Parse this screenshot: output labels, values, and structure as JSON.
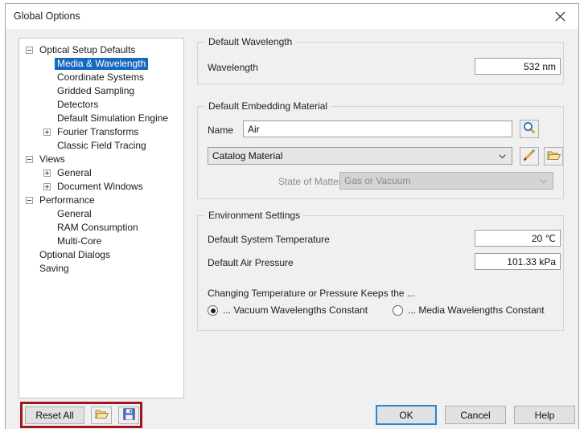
{
  "window": {
    "title": "Global Options",
    "close_icon": "close-icon"
  },
  "tree": {
    "nodes": [
      {
        "label": "Optical Setup Defaults",
        "indent": 0,
        "toggle": "minus",
        "selected": false
      },
      {
        "label": "Media & Wavelength",
        "indent": 1,
        "toggle": "none",
        "selected": true
      },
      {
        "label": "Coordinate Systems",
        "indent": 1,
        "toggle": "none",
        "selected": false
      },
      {
        "label": "Gridded Sampling",
        "indent": 1,
        "toggle": "none",
        "selected": false
      },
      {
        "label": "Detectors",
        "indent": 1,
        "toggle": "none",
        "selected": false
      },
      {
        "label": "Default Simulation Engine",
        "indent": 1,
        "toggle": "none",
        "selected": false
      },
      {
        "label": "Fourier Transforms",
        "indent": 1,
        "toggle": "plus",
        "selected": false
      },
      {
        "label": "Classic Field Tracing",
        "indent": 1,
        "toggle": "none",
        "selected": false
      },
      {
        "label": "Views",
        "indent": 0,
        "toggle": "minus",
        "selected": false
      },
      {
        "label": "General",
        "indent": 1,
        "toggle": "plus",
        "selected": false
      },
      {
        "label": "Document Windows",
        "indent": 1,
        "toggle": "plus",
        "selected": false
      },
      {
        "label": "Performance",
        "indent": 0,
        "toggle": "minus",
        "selected": false
      },
      {
        "label": "General",
        "indent": 1,
        "toggle": "none",
        "selected": false
      },
      {
        "label": "RAM Consumption",
        "indent": 1,
        "toggle": "none",
        "selected": false
      },
      {
        "label": "Multi-Core",
        "indent": 1,
        "toggle": "none",
        "selected": false
      },
      {
        "label": "Optional Dialogs",
        "indent": 0,
        "toggle": "none",
        "selected": false
      },
      {
        "label": "Saving",
        "indent": 0,
        "toggle": "none",
        "selected": false
      }
    ]
  },
  "wavelength_group": {
    "title": "Default Wavelength",
    "label": "Wavelength",
    "value": "532 nm"
  },
  "embedding_group": {
    "title": "Default Embedding Material",
    "name_label": "Name",
    "name_value": "Air",
    "search_icon": "search-icon",
    "material_type": "Catalog Material",
    "edit_icon": "pencil-icon",
    "open_icon": "folder-open-icon",
    "state_label": "State of Matter",
    "state_value": "Gas or Vacuum"
  },
  "environment_group": {
    "title": "Environment Settings",
    "temperature_label": "Default System Temperature",
    "temperature_value": "20 ℃",
    "pressure_label": "Default Air Pressure",
    "pressure_value": "101.33 kPa",
    "radio_prompt": "Changing Temperature or Pressure Keeps the ...",
    "radio_vacuum": "... Vacuum Wavelengths Constant",
    "radio_media": "... Media Wavelengths Constant"
  },
  "footer": {
    "reset_all": "Reset All",
    "load_icon": "folder-open-icon",
    "save_icon": "save-disk-icon",
    "ok": "OK",
    "cancel": "Cancel",
    "help": "Help"
  },
  "colors": {
    "selection_blue": "#1669c1",
    "default_button_border": "#1c8ad6",
    "highlight_red": "#a01722",
    "window_bg": "#f0f0f0"
  }
}
